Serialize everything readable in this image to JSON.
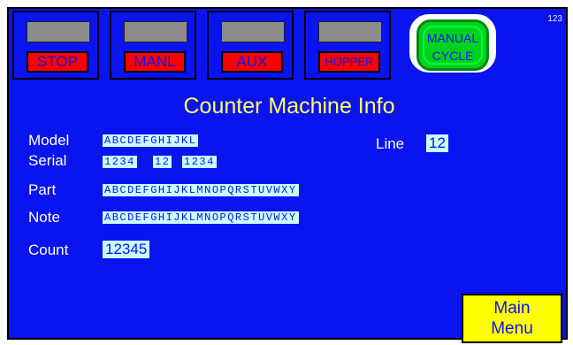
{
  "corner_number": "123",
  "top_buttons": [
    {
      "label": "STOP"
    },
    {
      "label": "MANL"
    },
    {
      "label": "AUX"
    },
    {
      "label": "HOPPER"
    }
  ],
  "manual_cycle": {
    "line1": "MANUAL",
    "line2": "CYCLE"
  },
  "title": "Counter Machine Info",
  "fields": {
    "model": {
      "label": "Model",
      "value": "ABCDEFGHIJKL"
    },
    "serial": {
      "label": "Serial",
      "values": [
        "1234",
        "12",
        "1234"
      ]
    },
    "line": {
      "label": "Line",
      "value": "12"
    },
    "part": {
      "label": "Part",
      "value": "ABCDEFGHIJKLMNOPQRSTUVWXY"
    },
    "note": {
      "label": "Note",
      "value": "ABCDEFGHIJKLMNOPQRSTUVWXY"
    },
    "count": {
      "label": "Count",
      "value": "12345"
    }
  },
  "main_menu": {
    "line1": "Main",
    "line2": "Menu"
  },
  "colors": {
    "background": "#0a14ee",
    "stop_red": "#ff0000",
    "indicator_gray": "#8c8c8c",
    "manual_green": "#00d21e",
    "title_yellow": "#ffff66",
    "field_cyan": "#c8ffff",
    "menu_yellow": "#ffff00"
  }
}
